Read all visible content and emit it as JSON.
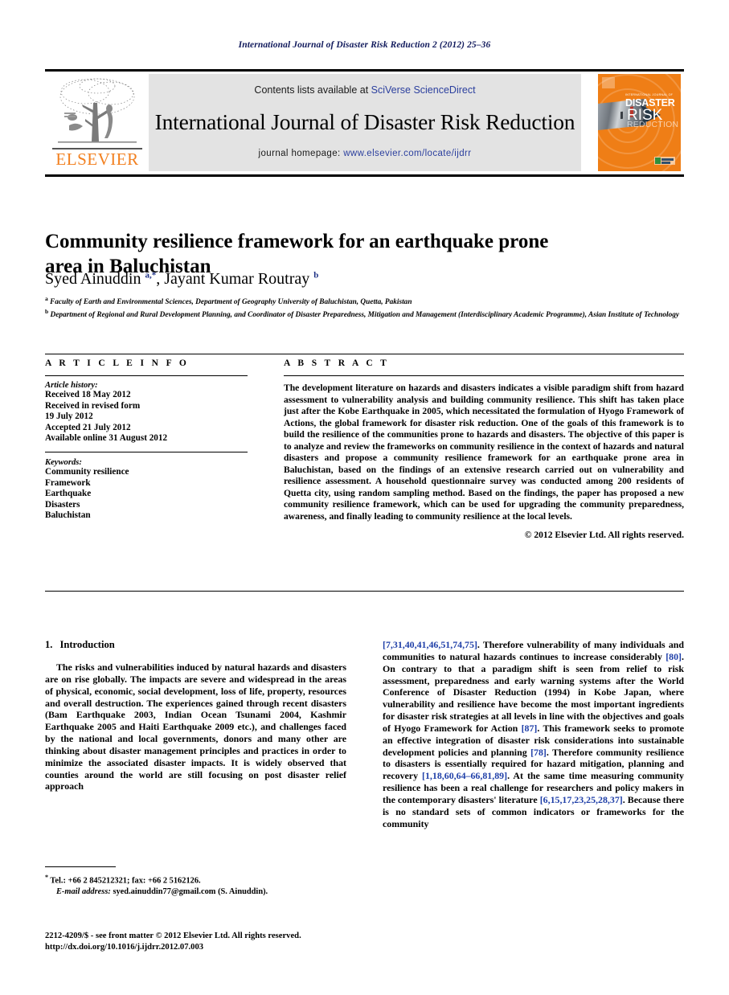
{
  "running_head": "International Journal of Disaster Risk Reduction 2 (2012) 25–36",
  "masthead": {
    "publisher_name": "ELSEVIER",
    "contents_prefix": "Contents lists available at ",
    "contents_link": "SciVerse ScienceDirect",
    "journal_title": "International Journal of Disaster Risk Reduction",
    "homepage_prefix": "journal homepage: ",
    "homepage_url": "www.elsevier.com/locate/ijdrr",
    "cover": {
      "superline": "INTERNATIONAL JOURNAL OF",
      "line1": "DISASTER",
      "line2": "RISK",
      "line3": "REDUCTION"
    }
  },
  "article": {
    "title": "Community resilience framework for an earthquake prone area in Baluchistan",
    "authors_html": "Syed Ainuddin <sup>a,</sup><sup>*</sup>, Jayant Kumar Routray <sup>b</sup>",
    "affiliations": [
      {
        "marker": "a",
        "text": "Faculty of Earth and Environmental Sciences, Department of Geography University of Baluchistan, Quetta, Pakistan"
      },
      {
        "marker": "b",
        "text": "Department of Regional and Rural Development Planning, and Coordinator of Disaster Preparedness, Mitigation and Management (Interdisciplinary Academic Programme), Asian Institute of Technology"
      }
    ]
  },
  "info": {
    "heading": "A R T I C L E   I N F O",
    "history_label": "Article history:",
    "history": [
      "Received 18 May 2012",
      "Received in revised form",
      "19 July 2012",
      "Accepted 21 July 2012",
      "Available online 31 August 2012"
    ],
    "keywords_label": "Keywords:",
    "keywords": [
      "Community resilience",
      "Framework",
      "Earthquake",
      "Disasters",
      "Baluchistan"
    ]
  },
  "abstract": {
    "heading": "A B S T R A C T",
    "text": "The development literature on hazards and disasters indicates a visible paradigm shift from hazard assessment to vulnerability analysis and building community resilience. This shift has taken place just after the Kobe Earthquake in 2005, which necessitated the formulation of Hyogo Framework of Actions, the global framework for disaster risk reduction. One of the goals of this framework is to build the resilience of the communities prone to hazards and disasters. The objective of this paper is to analyze and review the frameworks on community resilience in the context of hazards and natural disasters and propose a community resilience framework for an earthquake prone area in Baluchistan, based on the findings of an extensive research carried out on vulnerability and resilience assessment. A household questionnaire survey was conducted among 200 residents of Quetta city, using random sampling method. Based on the findings, the paper has proposed a new community resilience framework, which can be used for upgrading the community preparedness, awareness, and finally leading to community resilience at the local levels.",
    "copyright": "© 2012 Elsevier Ltd. All rights reserved."
  },
  "body": {
    "section_number": "1.",
    "section_title": "Introduction",
    "left_paragraph_html": "The risks and vulnerabilities induced by natural hazards and disasters are on rise globally. The impacts are severe and widespread in the areas of physical, economic, social development, loss of life, property, resources and overall destruction. The experiences gained through recent disasters (Bam Earthquake 2003, Indian Ocean Tsunami 2004, Kashmir Earthquake 2005 and Haiti Earthquake 2009 etc.), and challenges faced by the national and local governments, donors and many other are thinking about disaster management principles and practices in order to minimize the associated disaster impacts. It is widely observed that counties around the world are still focusing on post disaster relief approach",
    "right_paragraph_html": "<span class=\"ref\">[7,31,40,41,46,51,74,75]</span>. Therefore vulnerability of many individuals and communities to natural hazards continues to increase considerably <span class=\"ref\">[80]</span>. On contrary to that a paradigm shift is seen from relief to risk assessment, preparedness and early warning systems after the World Conference of Disaster Reduction (1994) in Kobe Japan, where vulnerability and resilience have become the most important ingredients for disaster risk strategies at all levels in line with the objectives and goals of Hyogo Framework for Action <span class=\"ref\">[87]</span>. This framework seeks to promote an effective integration of disaster risk considerations into sustainable development policies and planning <span class=\"ref\">[78]</span>. Therefore community resilience to disasters is essentially required for hazard mitigation, planning and recovery <span class=\"ref\">[1,18,60,64–66,81,89]</span>. At the same time measuring community resilience has been a real challenge for researchers and policy makers in the contemporary disasters' literature <span class=\"ref\">[6,15,17,23,25,28,37]</span>. Because there is no standard sets of common indicators or frameworks for the community"
  },
  "footnotes": {
    "corresponding_html": "<span class=\"star\">*</span> Tel.: +66 2 845212321; fax: +66 2 5162126.",
    "email_label": "E-mail address:",
    "email_text": " syed.ainuddin77@gmail.com (S. Ainuddin)."
  },
  "imprint": {
    "line1": "2212-4209/$ - see front matter © 2012 Elsevier Ltd. All rights reserved.",
    "line2": "http://dx.doi.org/10.1016/j.ijdrr.2012.07.003"
  },
  "colors": {
    "link_blue": "#2b3f9e",
    "ref_blue": "#1f3fa8",
    "elsevier_orange": "#f28020",
    "cover_orange": "#ef7e16",
    "banner_gray": "#e3e3e3",
    "runhead_navy": "#111a5c"
  }
}
